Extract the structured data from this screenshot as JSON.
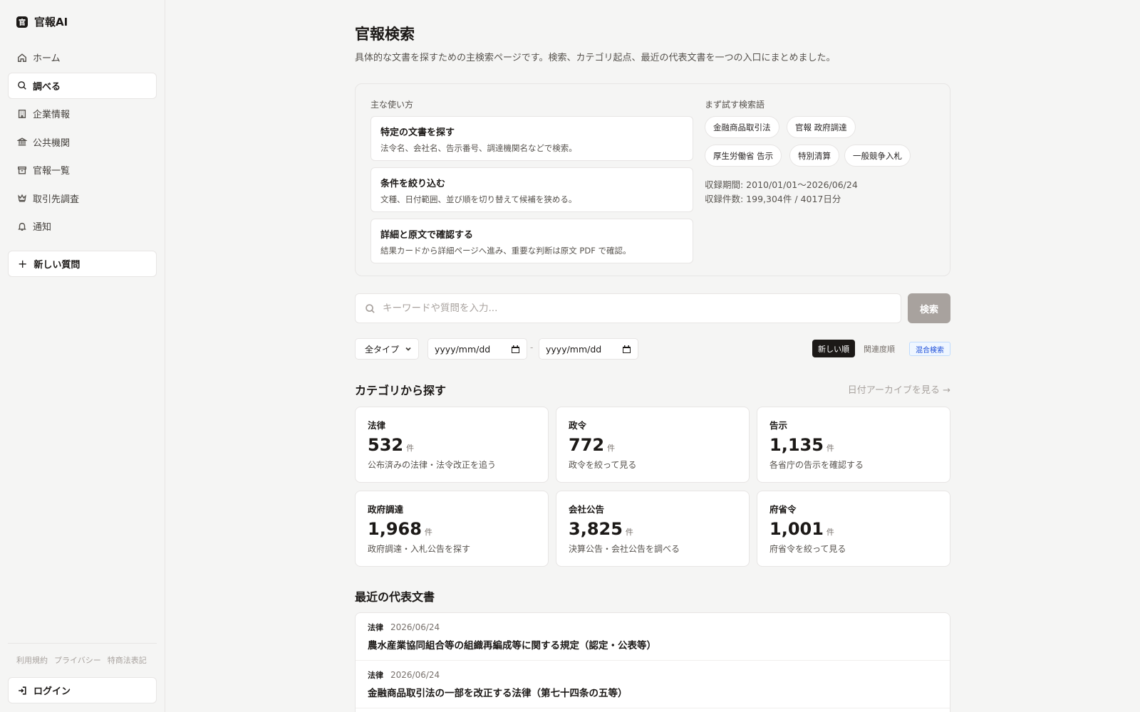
{
  "app": {
    "name": "官報AI"
  },
  "sidebar": {
    "items": [
      {
        "label": "ホーム",
        "icon": "home-icon"
      },
      {
        "label": "調べる",
        "icon": "search-icon",
        "active": true
      },
      {
        "label": "企業情報",
        "icon": "building-icon"
      },
      {
        "label": "公共機関",
        "icon": "landmark-icon"
      },
      {
        "label": "官報一覧",
        "icon": "archive-icon"
      },
      {
        "label": "取引先調査",
        "icon": "crown-icon"
      },
      {
        "label": "通知",
        "icon": "bell-icon"
      }
    ],
    "new_question": "新しい質問",
    "footer_links": [
      "利用規約",
      "プライバシー",
      "特商法表記"
    ],
    "login": "ログイン"
  },
  "page": {
    "title": "官報検索",
    "subtitle": "具体的な文書を探すための主検索ページです。検索、カテゴリ起点、最近の代表文書を一つの入口にまとめました。"
  },
  "howto": {
    "heading": "主な使い方",
    "cards": [
      {
        "title": "特定の文書を探す",
        "desc": "法令名、会社名、告示番号、調達機関名などで検索。"
      },
      {
        "title": "条件を絞り込む",
        "desc": "文種、日付範囲、並び順を切り替えて候補を狭める。"
      },
      {
        "title": "詳細と原文で確認する",
        "desc": "結果カードから詳細ページへ進み、重要な判断は原文 PDF で確認。"
      }
    ],
    "try_heading": "まず試す検索語",
    "chips": [
      "金融商品取引法",
      "官報 政府調達",
      "厚生労働省 告示",
      "特別清算",
      "一般競争入札"
    ],
    "period": "収録期間: 2010/01/01〜2026/06/24",
    "count": "収録件数: 199,304件 / 4017日分"
  },
  "search": {
    "placeholder": "キーワードや質問を入力...",
    "button": "検索"
  },
  "filters": {
    "type": "全タイプ",
    "date_from": "yyyy/mm/dd",
    "date_sep": "-",
    "date_to": "yyyy/mm/dd",
    "sort_new": "新しい順",
    "sort_relevance": "関連度順",
    "mode": "混合検索"
  },
  "categories": {
    "title": "カテゴリから探す",
    "archive_link": "日付アーカイブを見る →",
    "unit": "件",
    "items": [
      {
        "name": "法律",
        "count": "532",
        "desc": "公布済みの法律・法令改正を追う"
      },
      {
        "name": "政令",
        "count": "772",
        "desc": "政令を絞って見る"
      },
      {
        "name": "告示",
        "count": "1,135",
        "desc": "各省庁の告示を確認する"
      },
      {
        "name": "政府調達",
        "count": "1,968",
        "desc": "政府調達・入札公告を探す"
      },
      {
        "name": "会社公告",
        "count": "3,825",
        "desc": "決算公告・会社公告を調べる"
      },
      {
        "name": "府省令",
        "count": "1,001",
        "desc": "府省令を絞って見る"
      }
    ]
  },
  "recent": {
    "title": "最近の代表文書",
    "items": [
      {
        "category": "法律",
        "date": "2026/06/24",
        "title": "農水産業協同組合等の組織再編成等に関する規定（認定・公表等）"
      },
      {
        "category": "法律",
        "date": "2026/06/24",
        "title": "金融商品取引法の一部を改正する法律（第七十四条の五等）"
      }
    ]
  },
  "colors": {
    "accent_dark": "#1c1917",
    "badge_blue": "#1d4ed8",
    "muted": "#a8a29e"
  }
}
